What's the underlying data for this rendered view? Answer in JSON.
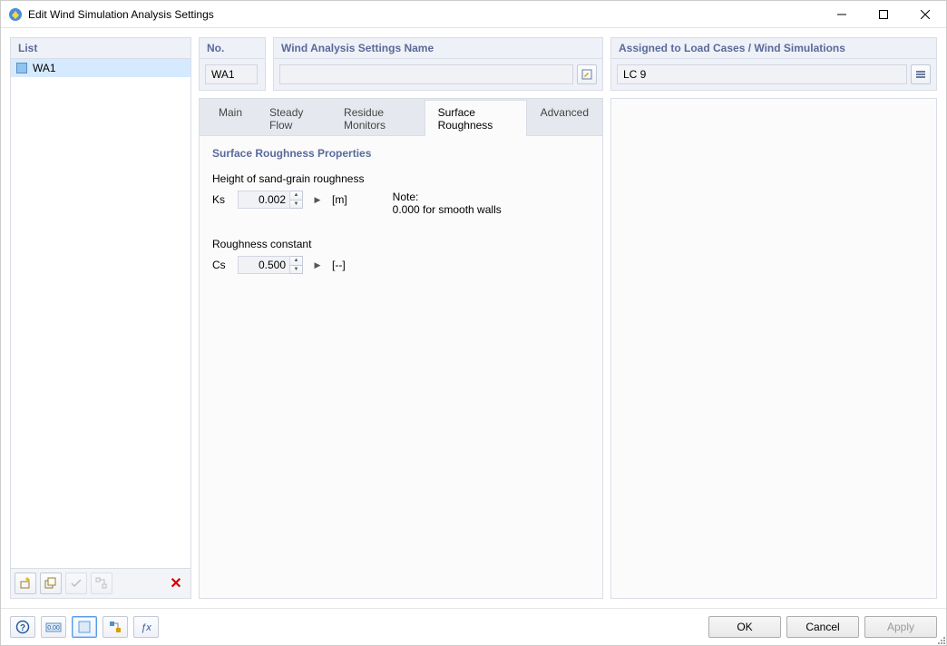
{
  "window": {
    "title": "Edit Wind Simulation Analysis Settings"
  },
  "listPanel": {
    "header": "List",
    "items": [
      "WA1"
    ]
  },
  "fields": {
    "noHeader": "No.",
    "noValue": "WA1",
    "nameHeader": "Wind Analysis Settings Name",
    "nameValue": "",
    "assignedHeader": "Assigned to Load Cases / Wind Simulations",
    "assignedValue": "LC 9"
  },
  "tabs": {
    "main": "Main",
    "steadyFlow": "Steady Flow",
    "residueMonitors": "Residue Monitors",
    "surfaceRoughness": "Surface Roughness",
    "advanced": "Advanced"
  },
  "section": {
    "title": "Surface Roughness Properties",
    "heightLabel": "Height of sand-grain roughness",
    "ksLabel": "Ks",
    "ksValue": "0.002",
    "ksUnit": "[m]",
    "noteLabel": "Note:",
    "noteText": "0.000 for smooth walls",
    "roughnessLabel": "Roughness constant",
    "csLabel": "Cs",
    "csValue": "0.500",
    "csUnit": "[--]"
  },
  "buttons": {
    "ok": "OK",
    "cancel": "Cancel",
    "apply": "Apply"
  }
}
